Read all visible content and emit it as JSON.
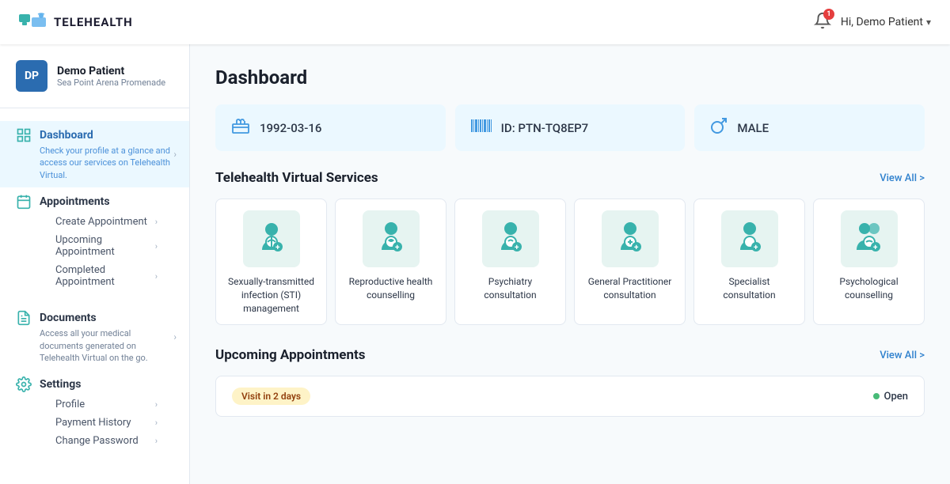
{
  "header": {
    "logo_text": "TELEHEALTH",
    "notification_count": "1",
    "user_greeting": "Hi, Demo Patient"
  },
  "sidebar": {
    "user": {
      "initials": "DP",
      "name": "Demo Patient",
      "location": "Sea Point Arena Promenade"
    },
    "nav_items": [
      {
        "id": "dashboard",
        "label": "Dashboard",
        "description": "Check your profile at a glance and access our services on Telehealth Virtual.",
        "active": true,
        "sub_items": []
      },
      {
        "id": "appointments",
        "label": "Appointments",
        "description": "",
        "active": false,
        "sub_items": [
          "Create Appointment",
          "Upcoming Appointment",
          "Completed Appointment"
        ]
      },
      {
        "id": "documents",
        "label": "Documents",
        "description": "Access all your medical documents generated on Telehealth Virtual on the go.",
        "active": false,
        "sub_items": []
      },
      {
        "id": "settings",
        "label": "Settings",
        "description": "",
        "active": false,
        "sub_items": [
          "Profile",
          "Payment History",
          "Change Password"
        ]
      }
    ]
  },
  "main": {
    "page_title": "Dashboard",
    "info_cards": [
      {
        "icon": "🎂",
        "value": "1992-03-16"
      },
      {
        "icon": "▌▌▌▌▌",
        "value": "ID: PTN-TQ8EP7"
      },
      {
        "icon": "♂",
        "value": "MALE"
      }
    ],
    "services_section": {
      "title": "Telehealth Virtual Services",
      "view_all": "View All >",
      "items": [
        {
          "label": "Sexually-transmitted infection (STI) management"
        },
        {
          "label": "Reproductive health counselling"
        },
        {
          "label": "Psychiatry consultation"
        },
        {
          "label": "General Practitioner consultation"
        },
        {
          "label": "Specialist consultation"
        },
        {
          "label": "Psychological counselling"
        }
      ]
    },
    "appointments_section": {
      "title": "Upcoming Appointments",
      "view_all": "View All >",
      "cards": [
        {
          "badge": "Visit in 2 days",
          "status": "Open"
        }
      ]
    }
  }
}
